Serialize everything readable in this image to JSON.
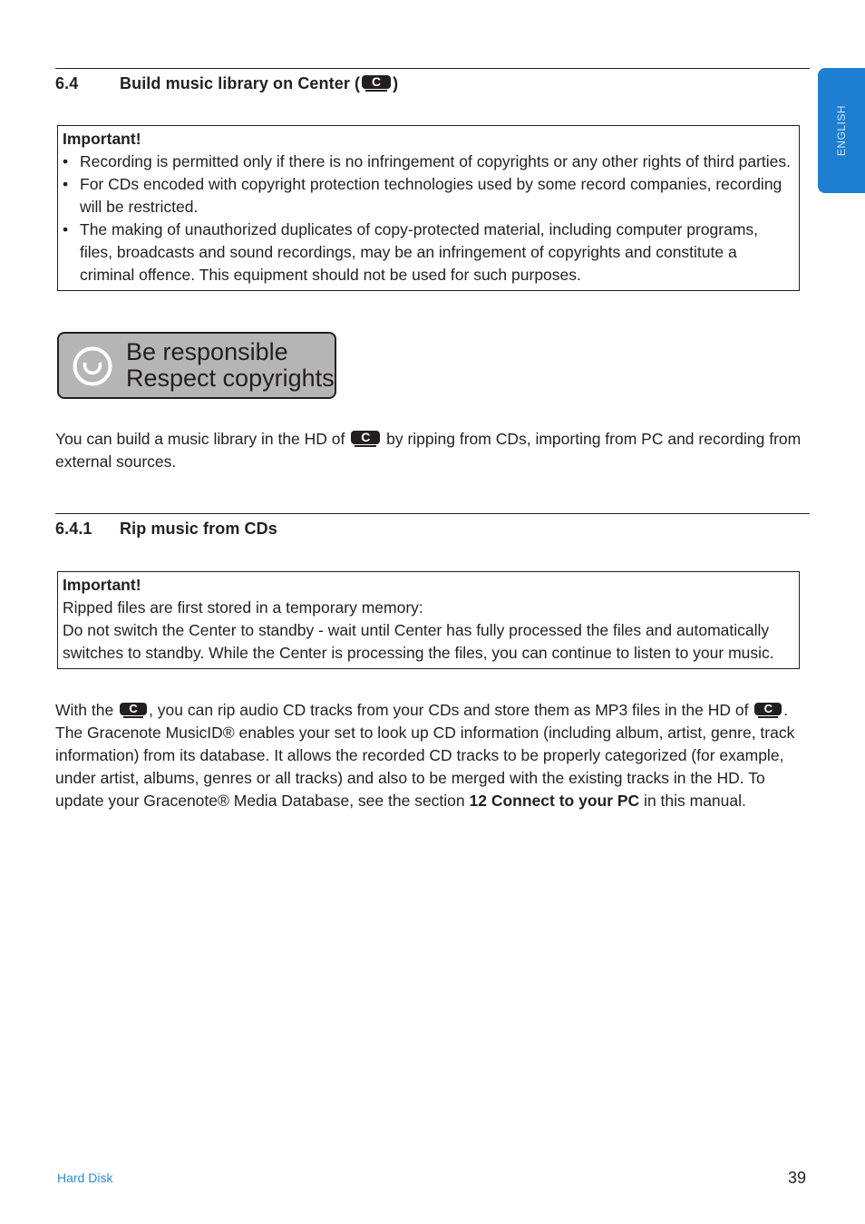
{
  "side_tab": {
    "label": "ENGLISH",
    "color": "#1e7fd0"
  },
  "section_6_4": {
    "number": "6.4",
    "title_before_icon": "Build music library on Center (",
    "title_after_icon": ")",
    "icon": "center-c-icon"
  },
  "important_box_1": {
    "title": "Important!",
    "bullets": [
      "Recording is permitted only if there is no infringement of copyrights or any other rights of third parties.",
      "For CDs encoded with copyright protection technologies used by some record companies, recording will be restricted.",
      "The making of unauthorized duplicates of copy-protected material, including computer programs, files, broadcasts and sound recordings, may be an infringement of copyrights and constitute a criminal offence. This equipment should not be used for such purposes."
    ]
  },
  "respect_badge": {
    "icon": "respect-copyright-logo-icon",
    "line1": "Be responsible",
    "line2": "Respect copyrights"
  },
  "intro_paragraph": {
    "before_icon": "You can build a music library in the HD of ",
    "after_icon": " by ripping from CDs, importing from PC and recording from external sources."
  },
  "section_6_4_1": {
    "number": "6.4.1",
    "title": "Rip music from CDs"
  },
  "important_box_2": {
    "title": "Important!",
    "line1": "Ripped files are first stored in a temporary memory:",
    "line2": "Do not switch the Center to standby - wait until Center has fully processed the files and automatically switches to standby. While the Center is processing the files, you can continue to listen to your music."
  },
  "rip_paragraph": {
    "part1": "With the ",
    "part2": ", you can rip audio CD tracks from your CDs and store them as MP3 files in the HD of ",
    "part3": ". The Gracenote MusicID®  enables your set to look up CD information (including album, artist, genre, track information) from its database. It allows the recorded CD tracks to be properly categorized (for example, under artist, albums, genres or all tracks) and also to be merged with the existing tracks in the HD. To update your Gracenote® Media Database, see the section ",
    "bold_ref": "12 Connect to your PC",
    "part4": " in this manual."
  },
  "icon_letter": "C",
  "footer": {
    "section": "Hard Disk",
    "page_number": "39"
  }
}
